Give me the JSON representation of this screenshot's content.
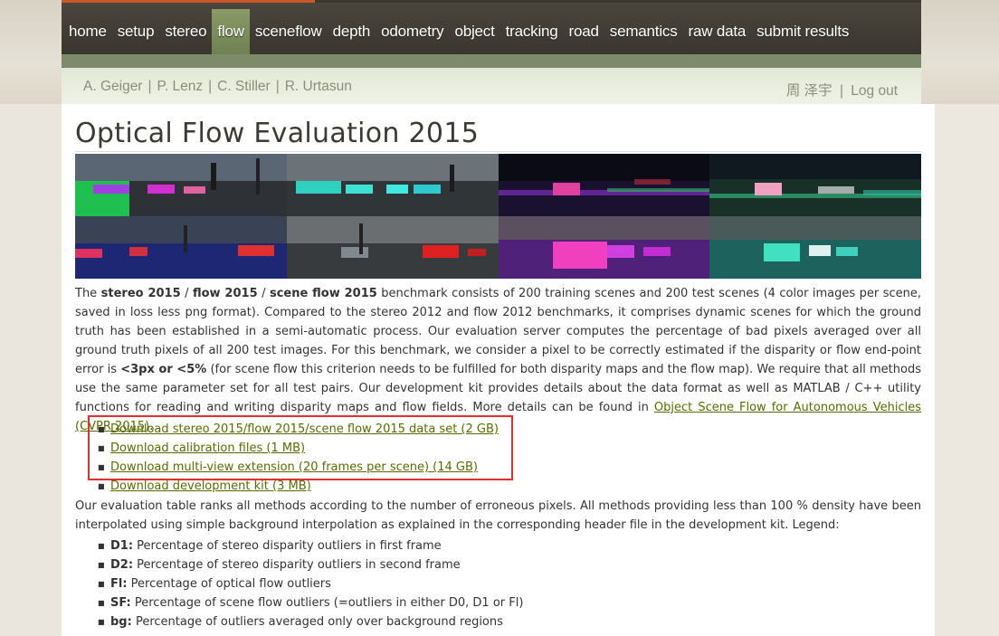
{
  "nav": {
    "items": [
      "home",
      "setup",
      "stereo",
      "flow",
      "sceneflow",
      "depth",
      "odometry",
      "object",
      "tracking",
      "road",
      "semantics",
      "raw data",
      "submit results"
    ],
    "active": "flow"
  },
  "subbar": {
    "authors": [
      "A. Geiger",
      "P. Lenz",
      "C. Stiller",
      "R. Urtasun"
    ],
    "username": "周 泽宇",
    "logout": "Log out"
  },
  "page": {
    "title": "Optical Flow Evaluation 2015"
  },
  "intro": {
    "p_start": "The ",
    "b1": "stereo 2015",
    "s1": " / ",
    "b2": "flow 2015",
    "s2": " / ",
    "b3": "scene flow 2015",
    "p_mid": " benchmark consists of 200 training scenes and 200 test scenes (4 color images per scene, saved in loss less png format). Compared to the stereo 2012 and flow 2012 benchmarks, it comprises dynamic scenes for which the ground truth has been established in a semi-automatic process. Our evaluation server computes the percentage of bad pixels averaged over all ground truth pixels of all 200 test images. For this benchmark, we consider a pixel to be correctly estimated if the disparity or flow end-point error is ",
    "b4": "<3px or <5%",
    "p_end": " (for scene flow this criterion needs to be fulfilled for both disparity maps and the flow map). We require that all methods use the same parameter set for all test pairs. Our development kit provides details about the data format as well as MATLAB / C++ utility functions for reading and writing disparity maps and flow fields. More details can be found in ",
    "link": "Object Scene Flow for Autonomous Vehicles (CVPR 2015)",
    "p_tail": "."
  },
  "downloads": [
    "Download stereo 2015/flow 2015/scene flow 2015 data set (2 GB)",
    "Download calibration files (1 MB)",
    "Download multi-view extension (20 frames per scene) (14 GB)",
    "Download development kit (3 MB)"
  ],
  "para2": "Our evaluation table ranks all methods according to the number of erroneous pixels. All methods providing less than 100 % density have been interpolated using simple background interpolation as explained in the corresponding header file in the development kit. Legend:",
  "legend": [
    {
      "key": "D1:",
      "text": " Percentage of stereo disparity outliers in first frame"
    },
    {
      "key": "D2:",
      "text": " Percentage of stereo disparity outliers in second frame"
    },
    {
      "key": "Fl:",
      "text": " Percentage of optical flow outliers"
    },
    {
      "key": "SF:",
      "text": " Percentage of scene flow outliers (=outliers in either D0, D1 or Fl)"
    },
    {
      "key": "bg:",
      "text": " Percentage of outliers averaged only over background regions"
    }
  ],
  "colors": {
    "nav_bg": "#3a362f",
    "nav_active": "#7a8c5a",
    "link": "#5a6a00",
    "highlight_box": "#e03030"
  }
}
